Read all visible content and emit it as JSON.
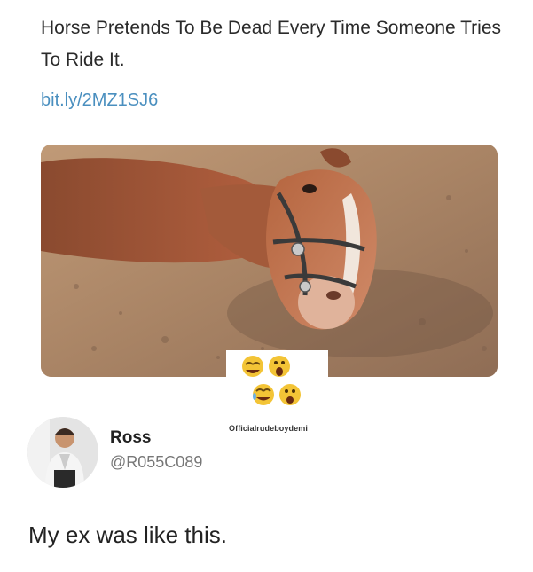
{
  "embed": {
    "headline": "Horse Pretends To Be Dead Every Time Someone Tries To Ride It.",
    "link": "bit.ly/2MZ1SJ6"
  },
  "photo": {
    "watermark": "Officialrudeboydemi"
  },
  "reactions": {
    "icons": [
      "laugh-icon",
      "wow-icon",
      "crying-laugh-icon",
      "shocked-icon"
    ]
  },
  "author": {
    "name": "Ross",
    "handle": "@R055C089"
  },
  "tweet": {
    "text": "My ex was like this."
  },
  "colors": {
    "link": "#4a8fbf",
    "text": "#222222",
    "handle": "#777777"
  }
}
